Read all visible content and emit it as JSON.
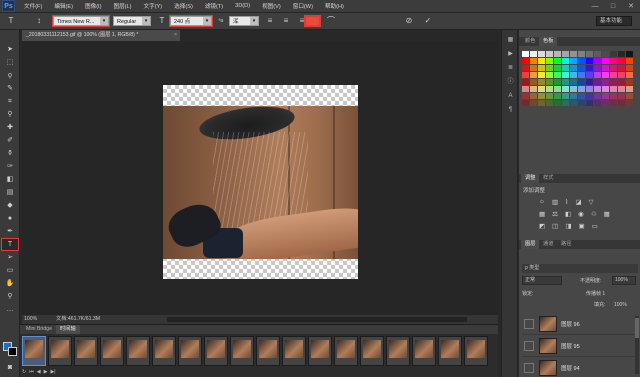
{
  "app": {
    "logo": "Ps"
  },
  "menu": [
    "文件(F)",
    "编辑(E)",
    "图像(I)",
    "图层(L)",
    "文字(Y)",
    "选择(S)",
    "滤镜(T)",
    "3D(D)",
    "视图(V)",
    "窗口(W)",
    "帮助(H)"
  ],
  "window_controls": [
    "—",
    "□",
    "✕"
  ],
  "options_bar": {
    "font_family": "Times New R...",
    "font_style": "Regular",
    "font_size": "240 点",
    "antialias": "浑",
    "workspace": "基本功能"
  },
  "document": {
    "tab_title": "_20180331112153.gif @ 100% (图层 1, RGB/8) *",
    "zoom": "100%",
    "doc_info": "文档:461.7K/61.3M"
  },
  "timeline": {
    "tabs": [
      "Mini Bridge",
      "时间轴"
    ],
    "active_tab": "时间轴",
    "frame_count": 18
  },
  "colors": {
    "foreground": "#1e6fb8",
    "background": "#000000",
    "highlight": "#e53935",
    "text_color_swatch": "#e84a3c"
  },
  "panels": {
    "swatch_tabs": [
      "颜色",
      "色板"
    ],
    "adjust_tabs": [
      "调整",
      "样式"
    ],
    "adjust_title": "添加调整",
    "layer_tabs": [
      "图层",
      "通道",
      "路径"
    ],
    "layer_filter": "ρ 类型",
    "blend_mode": "正常",
    "opacity_label": "不透明度:",
    "opacity": "100%",
    "lock_label": "锁定:",
    "propagate": "传播帧 1",
    "fill_label": "填充:",
    "fill": "100%",
    "layers": [
      "图层 96",
      "图层 95",
      "图层 94"
    ]
  }
}
